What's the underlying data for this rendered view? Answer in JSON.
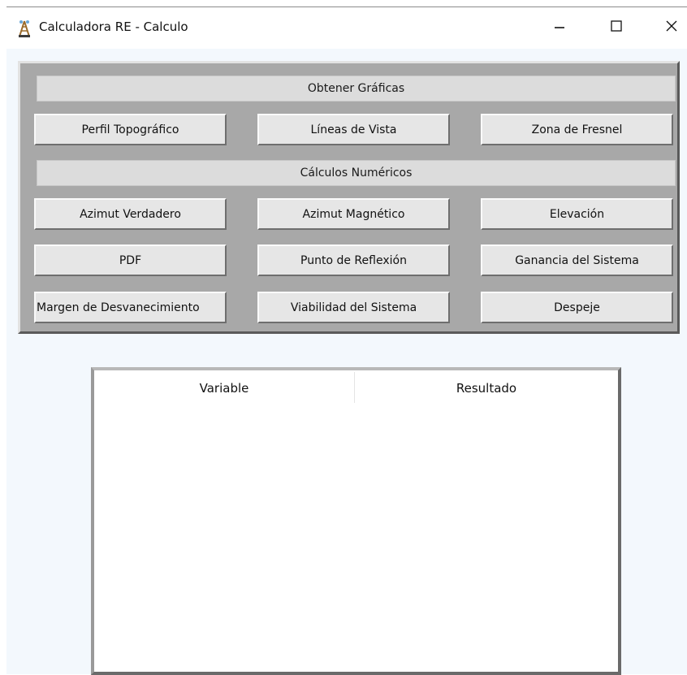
{
  "window": {
    "title": "Calculadora RE - Calculo",
    "icon": "antenna-tower-icon",
    "controls": {
      "minimize": "minimize-icon",
      "maximize": "maximize-icon",
      "close": "close-icon"
    }
  },
  "graphs": {
    "header": "Obtener Gráficas",
    "buttons": [
      "Perfil Topográfico",
      "Líneas de Vista",
      "Zona de Fresnel"
    ]
  },
  "numeric": {
    "header": "Cálculos Numéricos",
    "row1": [
      "Azimut Verdadero",
      "Azimut Magnético",
      "Elevación"
    ],
    "row2": [
      "PDF",
      "Punto de Reflexión",
      "Ganancia del Sistema"
    ],
    "row3": [
      "Margen de Desvanecimiento",
      "Viabilidad del Sistema",
      "Despeje"
    ]
  },
  "results": {
    "columns": [
      "Variable",
      "Resultado"
    ],
    "rows": []
  },
  "colors": {
    "panel": "#a8a8a8",
    "button": "#e6e6e6",
    "section_header": "#dcdcdc",
    "window_bg": "#f3f8fd"
  }
}
